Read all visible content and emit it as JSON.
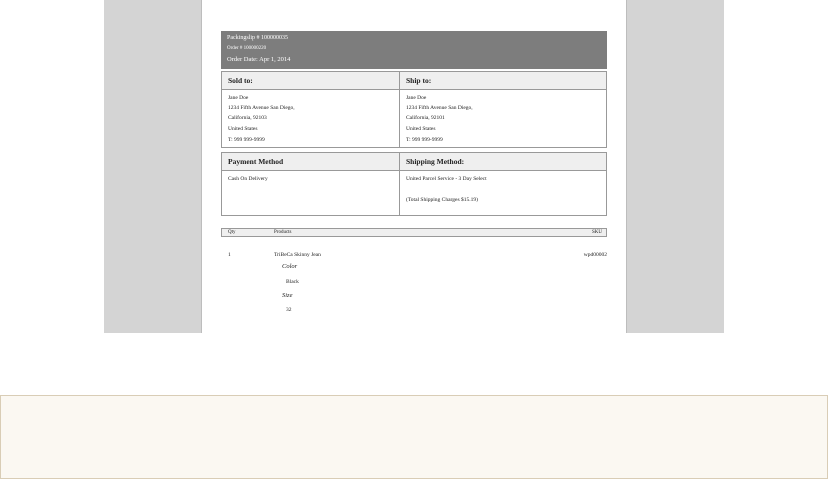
{
  "header": {
    "packingslip": "Packingslip # 100000035",
    "order": "Order # 100000220",
    "date": "Order Date: Apr 1, 2014"
  },
  "sold_to": {
    "title": "Sold to:",
    "lines": [
      "Jane Doe",
      "1234 Fifth Avenue San Diego,",
      "California, 92103",
      "United States",
      "T: 999 999-9999"
    ]
  },
  "ship_to": {
    "title": "Ship to:",
    "lines": [
      "Jane Doe",
      "1234 Fifth Avenue San Diego,",
      "California, 92101",
      "United States",
      "T: 999 999-9999"
    ]
  },
  "payment": {
    "title": "Payment Method",
    "value": "Cash On Delivery"
  },
  "shipping": {
    "title": "Shipping Method:",
    "value": "United Parcel Service - 3 Day Select",
    "charges": "(Total Shipping Charges $15.19)"
  },
  "items": {
    "headers": {
      "qty": "Qty",
      "products": "Products",
      "sku": "SKU"
    },
    "rows": [
      {
        "qty": "1",
        "name": "TriBeCa Skinny Jean",
        "sku": "wpd00002",
        "options": [
          {
            "label": "Color",
            "value": "Black"
          },
          {
            "label": "Size",
            "value": "32"
          }
        ]
      }
    ]
  }
}
